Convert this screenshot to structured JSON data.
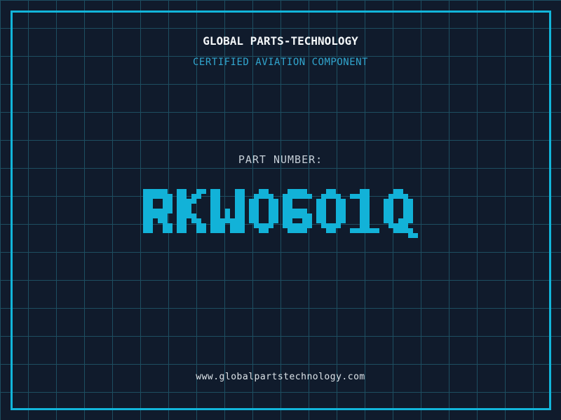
{
  "header": {
    "title": "GLOBAL PARTS-TECHNOLOGY",
    "subtitle": "CERTIFIED AVIATION COMPONENT"
  },
  "part": {
    "label": "PART NUMBER:",
    "number": "RKWO601Q"
  },
  "footer": {
    "website": "www.globalpartstechnology.com"
  },
  "colors": {
    "background": "#101b2c",
    "grid_line": "#1d4e61",
    "frame_cyan": "#12b5da",
    "title_white": "#f2f5f7",
    "subtitle_cyan": "#31a6cf",
    "label_gray": "#c5ced6",
    "part_number_cyan": "#12b2d8",
    "url_gray": "#dce3e8"
  }
}
